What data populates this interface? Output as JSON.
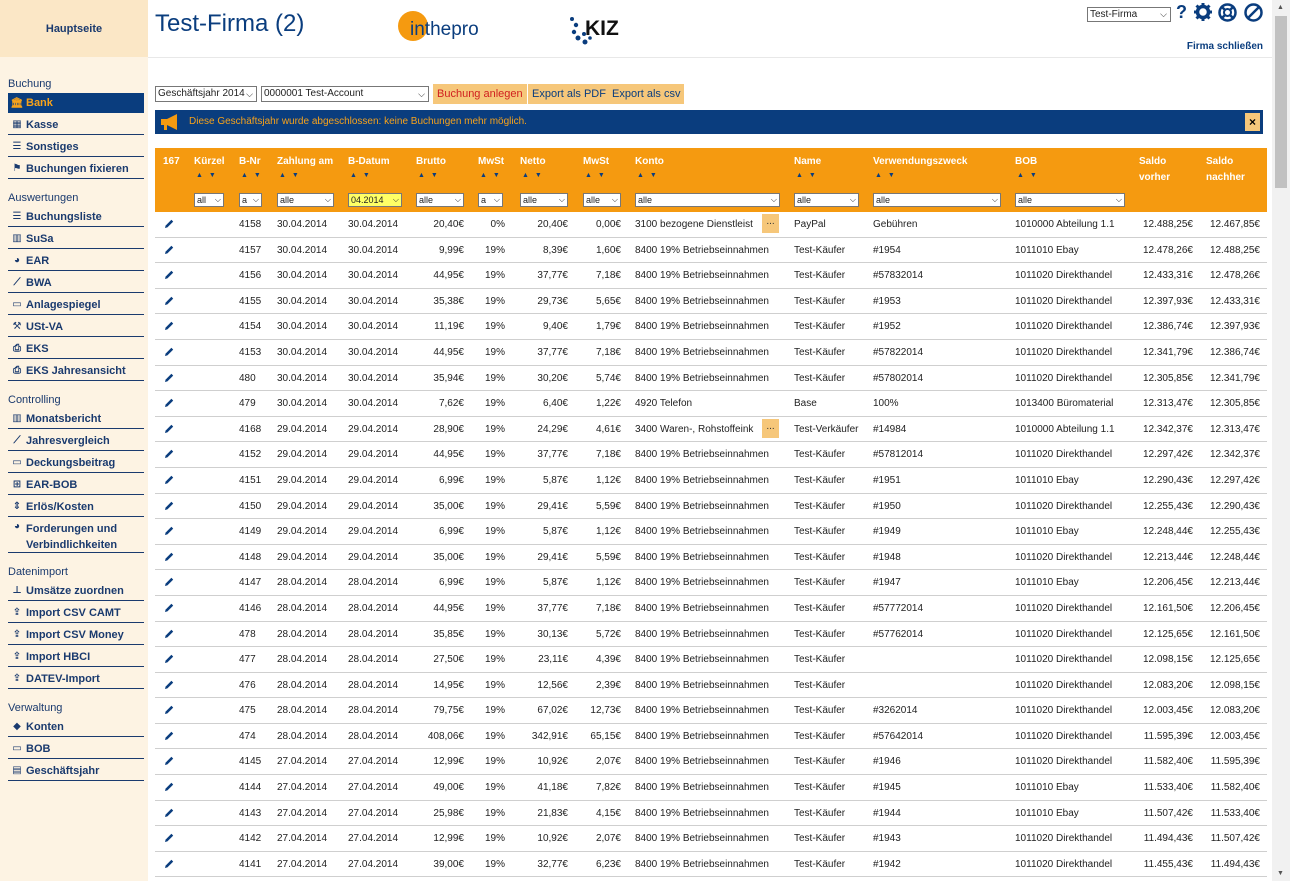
{
  "sidebar": {
    "home": "Hauptseite",
    "sections": [
      {
        "title": "Buchung",
        "items": [
          {
            "label": "Bank",
            "icon": "bank-icon",
            "active": true
          },
          {
            "label": "Kasse",
            "icon": "cash-register-icon"
          },
          {
            "label": "Sonstiges",
            "icon": "list-icon"
          },
          {
            "label": "Buchungen fixieren",
            "icon": "flag-icon"
          }
        ]
      },
      {
        "title": "Auswertungen",
        "items": [
          {
            "label": "Buchungsliste",
            "icon": "list-icon"
          },
          {
            "label": "SuSa",
            "icon": "bar-chart-icon"
          },
          {
            "label": "EAR",
            "icon": "pie-chart-icon"
          },
          {
            "label": "BWA",
            "icon": "line-chart-icon"
          },
          {
            "label": "Anlagespiegel",
            "icon": "monitor-icon"
          },
          {
            "label": "USt-VA",
            "icon": "gavel-icon"
          },
          {
            "label": "EKS",
            "icon": "printer-icon"
          },
          {
            "label": "EKS Jahresansicht",
            "icon": "printer-icon"
          }
        ]
      },
      {
        "title": "Controlling",
        "items": [
          {
            "label": "Monatsbericht",
            "icon": "bar-chart-icon"
          },
          {
            "label": "Jahresvergleich",
            "icon": "line-chart-icon"
          },
          {
            "label": "Deckungsbeitrag",
            "icon": "monitor-icon"
          },
          {
            "label": "EAR-BOB",
            "icon": "sitemap-icon"
          },
          {
            "label": "Erlös/Kosten",
            "icon": "arrows-v-icon"
          },
          {
            "label": "Forderungen und Verbindlichkeiten",
            "icon": "pie-chart-icon"
          }
        ]
      },
      {
        "title": "Datenimport",
        "items": [
          {
            "label": "Umsätze zuordnen",
            "icon": "pin-icon"
          },
          {
            "label": "Import CSV CAMT",
            "icon": "upload-icon"
          },
          {
            "label": "Import CSV Money",
            "icon": "upload-icon"
          },
          {
            "label": "Import HBCI",
            "icon": "upload-icon"
          },
          {
            "label": "DATEV-Import",
            "icon": "upload-icon"
          }
        ]
      },
      {
        "title": "Verwaltung",
        "items": [
          {
            "label": "Konten",
            "icon": "tags-icon"
          },
          {
            "label": "BOB",
            "icon": "monitor-icon"
          },
          {
            "label": "Geschäftsjahr",
            "icon": "briefcase-icon"
          }
        ]
      }
    ]
  },
  "header": {
    "title": "Test-Firma (2)",
    "logo1": "inthepro",
    "logo2": "KIZ",
    "firm_select": "Test-Firma",
    "close_firm": "Firma schließen"
  },
  "toolbar": {
    "year_select": "Geschäftsjahr 2014",
    "account_select": "0000001 Test-Account",
    "new_booking": "Buchung anlegen",
    "export_pdf": "Export als PDF",
    "export_csv": "Export als csv"
  },
  "banner": {
    "message": "Diese Geschäftsjahr wurde abgeschlossen: keine Buchungen mehr möglich.",
    "close": "×"
  },
  "table": {
    "count": "167",
    "headers": {
      "kuerzel": "Kürzel",
      "bnr": "B-Nr",
      "zahlung": "Zahlung am",
      "bdatum": "B-Datum",
      "brutto": "Brutto",
      "mwst1": "MwSt",
      "netto": "Netto",
      "mwst2": "MwSt",
      "konto": "Konto",
      "name": "Name",
      "zweck": "Verwendungszweck",
      "bob": "BOB",
      "saldo_vorher_1": "Saldo",
      "saldo_vorher_2": "vorher",
      "saldo_nachher_1": "Saldo",
      "saldo_nachher_2": "nachher"
    },
    "filters": {
      "kuerzel": "all",
      "bnr": "a",
      "zahlung": "alle",
      "bdatum": "04.2014",
      "brutto": "alle",
      "mwst1": "a",
      "netto": "alle",
      "mwst2": "alle",
      "konto": "alle",
      "name": "alle",
      "zweck": "alle",
      "bob": "alle"
    },
    "rows": [
      [
        "4158",
        "30.04.2014",
        "30.04.2014",
        "20,40€",
        "0%",
        "20,40€",
        "0,00€",
        "3100 bezogene Dienstleist",
        "PayPal",
        "Gebühren",
        "1010000 Abteilung 1.1",
        "12.488,25€",
        "12.467,85€",
        true
      ],
      [
        "4157",
        "30.04.2014",
        "30.04.2014",
        "9,99€",
        "19%",
        "8,39€",
        "1,60€",
        "8400 19% Betriebseinnahmen",
        "Test-Käufer",
        "#1954",
        "1011010 Ebay",
        "12.478,26€",
        "12.488,25€",
        false
      ],
      [
        "4156",
        "30.04.2014",
        "30.04.2014",
        "44,95€",
        "19%",
        "37,77€",
        "7,18€",
        "8400 19% Betriebseinnahmen",
        "Test-Käufer",
        "#57832014",
        "1011020 Direkthandel",
        "12.433,31€",
        "12.478,26€",
        false
      ],
      [
        "4155",
        "30.04.2014",
        "30.04.2014",
        "35,38€",
        "19%",
        "29,73€",
        "5,65€",
        "8400 19% Betriebseinnahmen",
        "Test-Käufer",
        "#1953",
        "1011020 Direkthandel",
        "12.397,93€",
        "12.433,31€",
        false
      ],
      [
        "4154",
        "30.04.2014",
        "30.04.2014",
        "11,19€",
        "19%",
        "9,40€",
        "1,79€",
        "8400 19% Betriebseinnahmen",
        "Test-Käufer",
        "#1952",
        "1011020 Direkthandel",
        "12.386,74€",
        "12.397,93€",
        false
      ],
      [
        "4153",
        "30.04.2014",
        "30.04.2014",
        "44,95€",
        "19%",
        "37,77€",
        "7,18€",
        "8400 19% Betriebseinnahmen",
        "Test-Käufer",
        "#57822014",
        "1011020 Direkthandel",
        "12.341,79€",
        "12.386,74€",
        false
      ],
      [
        "480",
        "30.04.2014",
        "30.04.2014",
        "35,94€",
        "19%",
        "30,20€",
        "5,74€",
        "8400 19% Betriebseinnahmen",
        "Test-Käufer",
        "#57802014",
        "1011020 Direkthandel",
        "12.305,85€",
        "12.341,79€",
        false
      ],
      [
        "479",
        "30.04.2014",
        "30.04.2014",
        "7,62€",
        "19%",
        "6,40€",
        "1,22€",
        "4920 Telefon",
        "Base",
        "100%",
        "1013400 Büromaterial",
        "12.313,47€",
        "12.305,85€",
        false
      ],
      [
        "4168",
        "29.04.2014",
        "29.04.2014",
        "28,90€",
        "19%",
        "24,29€",
        "4,61€",
        "3400 Waren-, Rohstoffeink",
        "Test-Verkäufer",
        "#14984",
        "1010000 Abteilung 1.1",
        "12.342,37€",
        "12.313,47€",
        true
      ],
      [
        "4152",
        "29.04.2014",
        "29.04.2014",
        "44,95€",
        "19%",
        "37,77€",
        "7,18€",
        "8400 19% Betriebseinnahmen",
        "Test-Käufer",
        "#57812014",
        "1011020 Direkthandel",
        "12.297,42€",
        "12.342,37€",
        false
      ],
      [
        "4151",
        "29.04.2014",
        "29.04.2014",
        "6,99€",
        "19%",
        "5,87€",
        "1,12€",
        "8400 19% Betriebseinnahmen",
        "Test-Käufer",
        "#1951",
        "1011010 Ebay",
        "12.290,43€",
        "12.297,42€",
        false
      ],
      [
        "4150",
        "29.04.2014",
        "29.04.2014",
        "35,00€",
        "19%",
        "29,41€",
        "5,59€",
        "8400 19% Betriebseinnahmen",
        "Test-Käufer",
        "#1950",
        "1011020 Direkthandel",
        "12.255,43€",
        "12.290,43€",
        false
      ],
      [
        "4149",
        "29.04.2014",
        "29.04.2014",
        "6,99€",
        "19%",
        "5,87€",
        "1,12€",
        "8400 19% Betriebseinnahmen",
        "Test-Käufer",
        "#1949",
        "1011010 Ebay",
        "12.248,44€",
        "12.255,43€",
        false
      ],
      [
        "4148",
        "29.04.2014",
        "29.04.2014",
        "35,00€",
        "19%",
        "29,41€",
        "5,59€",
        "8400 19% Betriebseinnahmen",
        "Test-Käufer",
        "#1948",
        "1011020 Direkthandel",
        "12.213,44€",
        "12.248,44€",
        false
      ],
      [
        "4147",
        "28.04.2014",
        "28.04.2014",
        "6,99€",
        "19%",
        "5,87€",
        "1,12€",
        "8400 19% Betriebseinnahmen",
        "Test-Käufer",
        "#1947",
        "1011010 Ebay",
        "12.206,45€",
        "12.213,44€",
        false
      ],
      [
        "4146",
        "28.04.2014",
        "28.04.2014",
        "44,95€",
        "19%",
        "37,77€",
        "7,18€",
        "8400 19% Betriebseinnahmen",
        "Test-Käufer",
        "#57772014",
        "1011020 Direkthandel",
        "12.161,50€",
        "12.206,45€",
        false
      ],
      [
        "478",
        "28.04.2014",
        "28.04.2014",
        "35,85€",
        "19%",
        "30,13€",
        "5,72€",
        "8400 19% Betriebseinnahmen",
        "Test-Käufer",
        "#57762014",
        "1011020 Direkthandel",
        "12.125,65€",
        "12.161,50€",
        false
      ],
      [
        "477",
        "28.04.2014",
        "28.04.2014",
        "27,50€",
        "19%",
        "23,11€",
        "4,39€",
        "8400 19% Betriebseinnahmen",
        "Test-Käufer",
        "",
        "1011020 Direkthandel",
        "12.098,15€",
        "12.125,65€",
        false
      ],
      [
        "476",
        "28.04.2014",
        "28.04.2014",
        "14,95€",
        "19%",
        "12,56€",
        "2,39€",
        "8400 19% Betriebseinnahmen",
        "Test-Käufer",
        "",
        "1011020 Direkthandel",
        "12.083,20€",
        "12.098,15€",
        false
      ],
      [
        "475",
        "28.04.2014",
        "28.04.2014",
        "79,75€",
        "19%",
        "67,02€",
        "12,73€",
        "8400 19% Betriebseinnahmen",
        "Test-Käufer",
        "#3262014",
        "1011020 Direkthandel",
        "12.003,45€",
        "12.083,20€",
        false
      ],
      [
        "474",
        "28.04.2014",
        "28.04.2014",
        "408,06€",
        "19%",
        "342,91€",
        "65,15€",
        "8400 19% Betriebseinnahmen",
        "Test-Käufer",
        "#57642014",
        "1011020 Direkthandel",
        "11.595,39€",
        "12.003,45€",
        false
      ],
      [
        "4145",
        "27.04.2014",
        "27.04.2014",
        "12,99€",
        "19%",
        "10,92€",
        "2,07€",
        "8400 19% Betriebseinnahmen",
        "Test-Käufer",
        "#1946",
        "1011020 Direkthandel",
        "11.582,40€",
        "11.595,39€",
        false
      ],
      [
        "4144",
        "27.04.2014",
        "27.04.2014",
        "49,00€",
        "19%",
        "41,18€",
        "7,82€",
        "8400 19% Betriebseinnahmen",
        "Test-Käufer",
        "#1945",
        "1011010 Ebay",
        "11.533,40€",
        "11.582,40€",
        false
      ],
      [
        "4143",
        "27.04.2014",
        "27.04.2014",
        "25,98€",
        "19%",
        "21,83€",
        "4,15€",
        "8400 19% Betriebseinnahmen",
        "Test-Käufer",
        "#1944",
        "1011010 Ebay",
        "11.507,42€",
        "11.533,40€",
        false
      ],
      [
        "4142",
        "27.04.2014",
        "27.04.2014",
        "12,99€",
        "19%",
        "10,92€",
        "2,07€",
        "8400 19% Betriebseinnahmen",
        "Test-Käufer",
        "#1943",
        "1011020 Direkthandel",
        "11.494,43€",
        "11.507,42€",
        false
      ],
      [
        "4141",
        "27.04.2014",
        "27.04.2014",
        "39,00€",
        "19%",
        "32,77€",
        "6,23€",
        "8400 19% Betriebseinnahmen",
        "Test-Käufer",
        "#1942",
        "1011020 Direkthandel",
        "11.455,43€",
        "11.494,43€",
        false
      ]
    ],
    "more_button": "..."
  },
  "colors": {
    "navy": "#0a3d7e",
    "orange": "#f59a10",
    "button_bg": "#f6c77a",
    "sidebar_bg": "#fdf3e3"
  }
}
